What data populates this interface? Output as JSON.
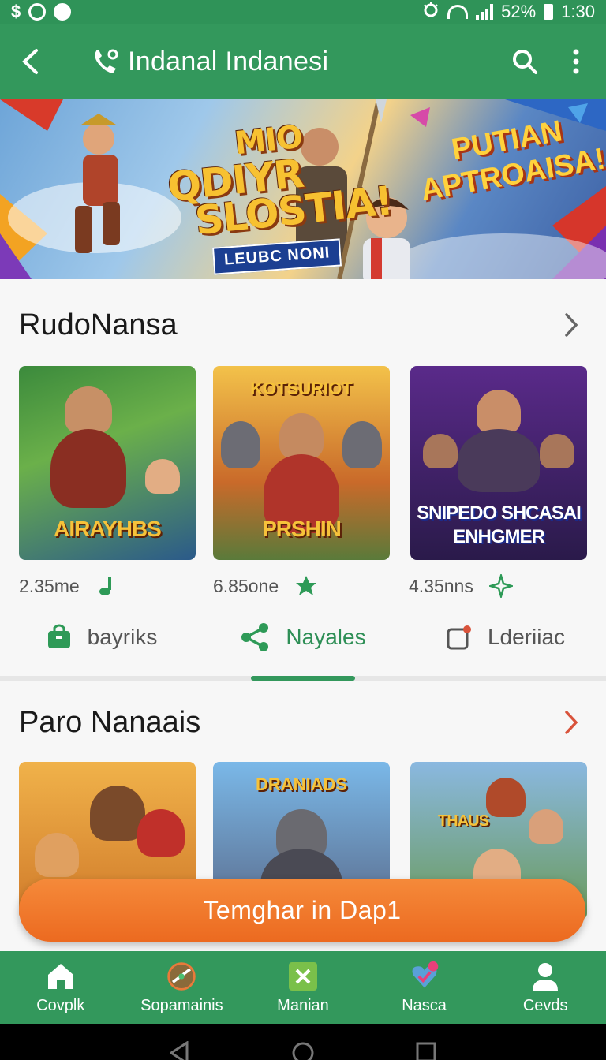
{
  "status_bar": {
    "battery": "52%",
    "time": "1:30"
  },
  "app_bar": {
    "title": "Indanal Indanesi"
  },
  "banner": {
    "title_line1": "MIO",
    "title_line2": "QDIYR",
    "title_line3": "SLOSTIA!",
    "ribbon": "LEUBC NONI",
    "tag_line1": "PUTIAN",
    "tag_line2": "APTROAISA!"
  },
  "section1": {
    "title": "RudoNansa",
    "cards": [
      {
        "art_text": "AIRAYHBS",
        "art_top": "",
        "meta": "2.35me",
        "meta_icon": "music-note-icon"
      },
      {
        "art_text": "PRSHIN",
        "art_top": "KOTSURIOT",
        "meta": "6.85one",
        "meta_icon": "star-badge-icon"
      },
      {
        "art_text": "SNIPEDO SHCASAI ENHGMER",
        "art_top": "",
        "meta": "4.35nns",
        "meta_icon": "sparkle-icon"
      }
    ]
  },
  "tabs": [
    {
      "label": "bayriks",
      "icon": "shopping-bag-icon",
      "active": false
    },
    {
      "label": "Nayales",
      "icon": "share-icon",
      "active": true
    },
    {
      "label": "Lderiiac",
      "icon": "notification-square-icon",
      "active": false
    }
  ],
  "section2": {
    "title": "Paro Nanaais",
    "cards": [
      {
        "art_text": "",
        "art_top": ""
      },
      {
        "art_text": "",
        "art_top": "DRANIADS"
      },
      {
        "art_text": "THAUS",
        "art_top": ""
      }
    ]
  },
  "cta": {
    "label": "Temghar in Dap1"
  },
  "bottom_nav": [
    {
      "label": "Covplk",
      "icon": "home-icon"
    },
    {
      "label": "Sopamainis",
      "icon": "compass-icon"
    },
    {
      "label": "Manian",
      "icon": "cross-tile-icon"
    },
    {
      "label": "Nasca",
      "icon": "heart-badge-icon"
    },
    {
      "label": "Cevds",
      "icon": "person-icon"
    }
  ],
  "colors": {
    "primary": "#33985c",
    "accent": "#ec6a20",
    "chevron_alt": "#d9533b"
  }
}
